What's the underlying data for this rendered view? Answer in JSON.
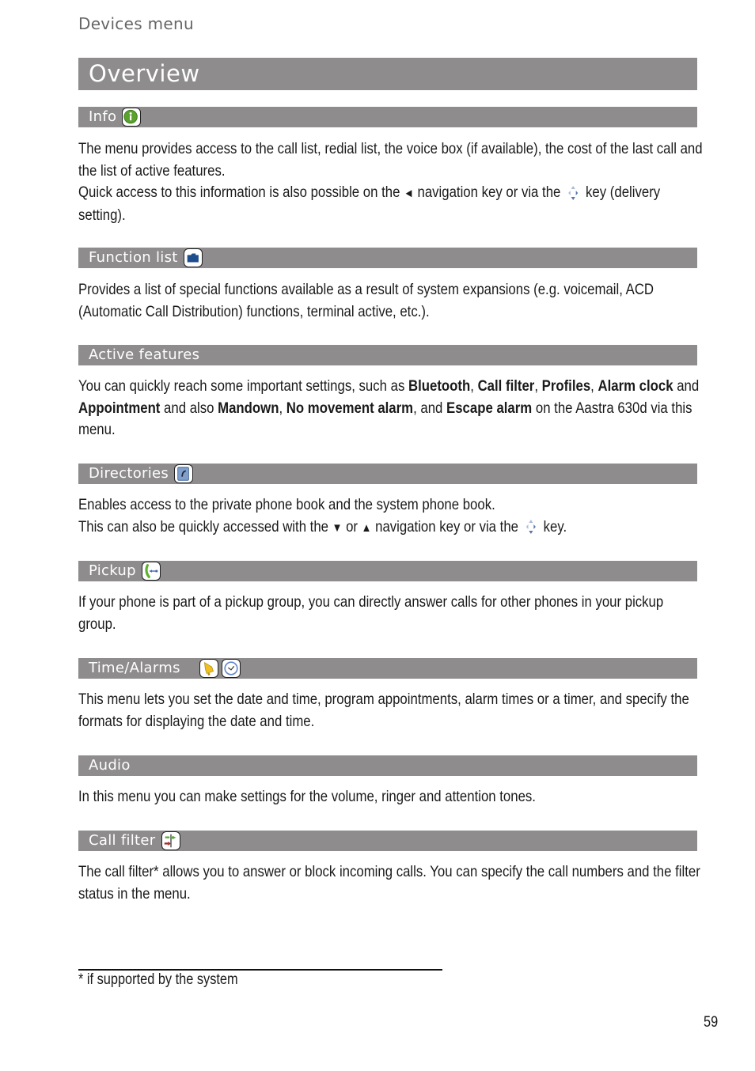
{
  "running_head": "Devices menu",
  "title": "Overview",
  "sections": [
    {
      "heading": "Info",
      "icon": "info-icon"
    },
    {
      "heading": "Function list",
      "icon": "folder-icon"
    },
    {
      "heading": "Active features",
      "icon": null
    },
    {
      "heading": "Directories",
      "icon": "phonebook-icon"
    },
    {
      "heading": "Pickup",
      "icon": "pickup-icon"
    },
    {
      "heading": "Time/Alarms",
      "icons": [
        "bell-icon",
        "clock-icon"
      ]
    },
    {
      "heading": "Audio",
      "icon": null
    },
    {
      "heading": "Call filter",
      "icon": "call-filter-icon"
    }
  ],
  "info": {
    "line1": "The menu provides access to the call list, redial list, the voice box (if available), the cost of the last call and the list of active features.",
    "line2a": "Quick access to this information is also possible on the",
    "line2b": "navigation key or via the",
    "line2c": "key (delivery setting).",
    "left_arrow": "◄"
  },
  "function_list": {
    "text": "Provides a list of special functions available as a result of system expansions (e.g. voicemail, ACD (Automatic Call Distribution) functions, terminal active, etc.)."
  },
  "active_features": {
    "t1": "You can quickly reach some important settings, such as ",
    "b1": "Bluetooth",
    "t2": ",  ",
    "b2": "Call filter",
    "t3": ", ",
    "b3": "Profiles",
    "t4": ", ",
    "b4": "Alarm clock",
    "t5": " and ",
    "b5": "Appointment",
    "t6": " and also ",
    "b6": "Mandown",
    "t7": ", ",
    "b7": "No movement alarm",
    "t8": ", and ",
    "b8": "Escape alarm",
    "t9": " on the Aastra 630d via this menu."
  },
  "directories": {
    "line1": "Enables access to the private phone book and the system phone book.",
    "line2a": "This can also be quickly accessed with the",
    "down_arrow": "▼",
    "or": "or",
    "up_arrow": "▲",
    "line2b": "navigation key or via the",
    "line2c": "key."
  },
  "pickup": {
    "text": "If your phone is part of a pickup group, you can directly answer calls for other phones in your pickup group."
  },
  "time_alarms": {
    "text": "This menu lets you set the date and time, program appointments, alarm times or a timer, and specify the formats for displaying the date and time."
  },
  "audio": {
    "text": "In this menu you can make settings for the volume, ringer and attention tones."
  },
  "call_filter": {
    "text": "The call filter* allows you to answer or block incoming calls. You can specify the call numbers and the filter status in the menu."
  },
  "footnote": "* if supported by the system",
  "page_number": "59"
}
